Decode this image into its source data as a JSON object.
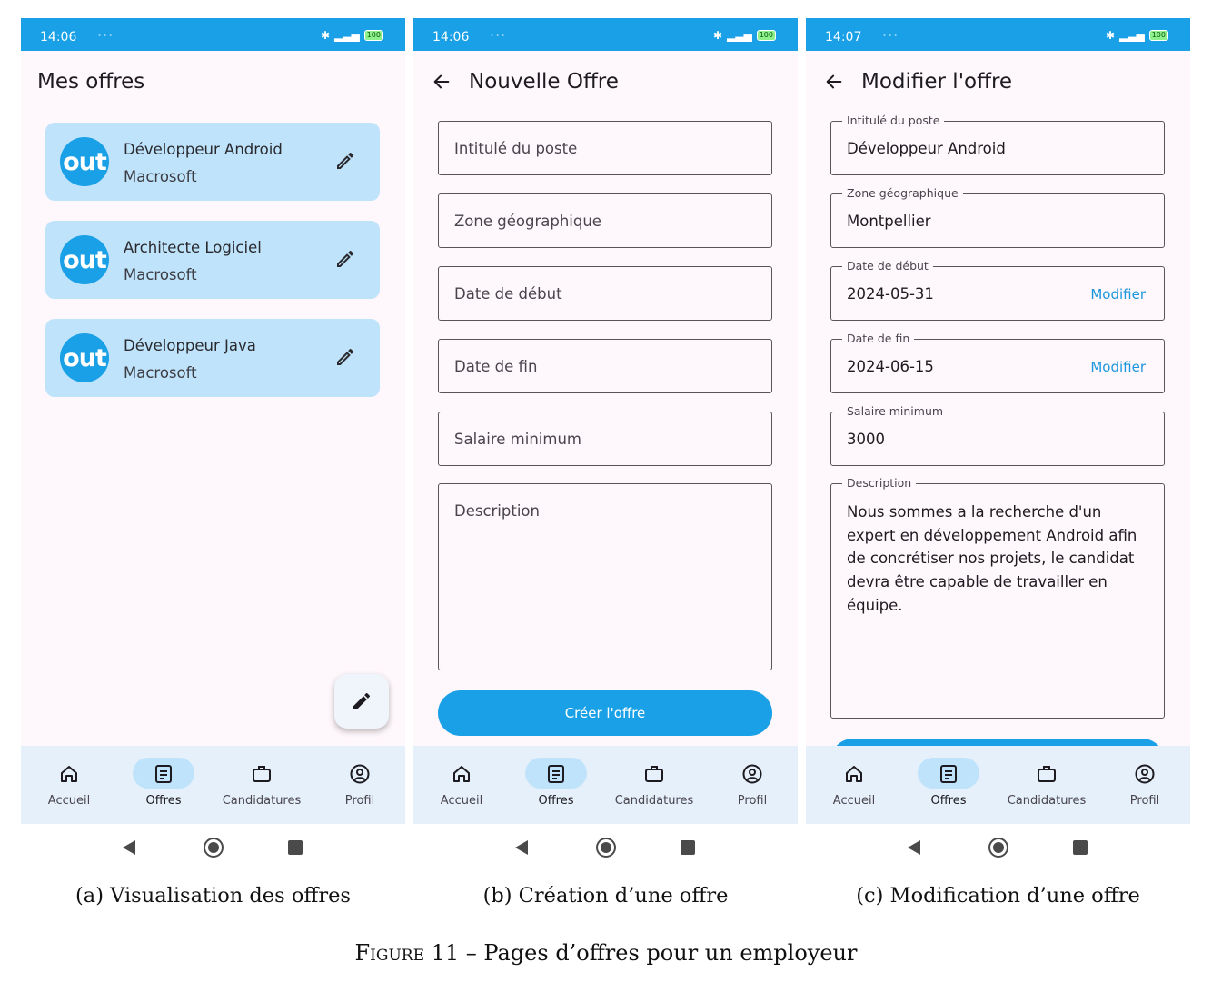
{
  "status_bars": [
    {
      "time": "14:06"
    },
    {
      "time": "14:06"
    },
    {
      "time": "14:07"
    }
  ],
  "status_common": {
    "dots": "···",
    "battery": "100"
  },
  "screen_a": {
    "title": "Mes offres",
    "offers": [
      {
        "logo": "out",
        "title": "Développeur Android",
        "company": "Macrosoft"
      },
      {
        "logo": "out",
        "title": "Architecte Logiciel",
        "company": "Macrosoft"
      },
      {
        "logo": "out",
        "title": "Développeur Java",
        "company": "Macrosoft"
      }
    ]
  },
  "screen_b": {
    "title": "Nouvelle Offre",
    "fields": [
      {
        "placeholder": "Intitulé du poste"
      },
      {
        "placeholder": "Zone géographique"
      },
      {
        "placeholder": "Date de début"
      },
      {
        "placeholder": "Date de fin"
      },
      {
        "placeholder": "Salaire minimum"
      },
      {
        "placeholder": "Description"
      }
    ],
    "button": "Créer l'offre"
  },
  "screen_c": {
    "title": "Modifier l'offre",
    "fields": [
      {
        "label": "Intitulé du poste",
        "value": "Développeur Android"
      },
      {
        "label": "Zone géographique",
        "value": "Montpellier"
      },
      {
        "label": "Date de début",
        "value": "2024-05-31",
        "action": "Modifier"
      },
      {
        "label": "Date de fin",
        "value": "2024-06-15",
        "action": "Modifier"
      },
      {
        "label": "Salaire minimum",
        "value": "3000"
      },
      {
        "label": "Description",
        "value": "Nous sommes a la recherche d'un expert en développement Android afin de concrétiser nos projets, le candidat devra être capable de travailler en équipe."
      }
    ]
  },
  "bottom_nav": {
    "items": [
      {
        "label": "Accueil",
        "icon": "home-icon"
      },
      {
        "label": "Offres",
        "icon": "document-icon",
        "active": true
      },
      {
        "label": "Candidatures",
        "icon": "briefcase-icon"
      },
      {
        "label": "Profil",
        "icon": "account-circle-icon"
      }
    ]
  },
  "captions": {
    "a": "(a) Visualisation des offres",
    "b": "(b) Création d’une offre",
    "c": "(c) Modification d’une offre",
    "figure_word": "Figure",
    "figure_rest": " 11 – Pages d’offres pour un employeur"
  },
  "colors": {
    "accent": "#1aa0e6",
    "card": "#bee3fb",
    "background": "#fef7fb",
    "nav_background": "#e6f0fa",
    "link": "#1a96dd"
  }
}
